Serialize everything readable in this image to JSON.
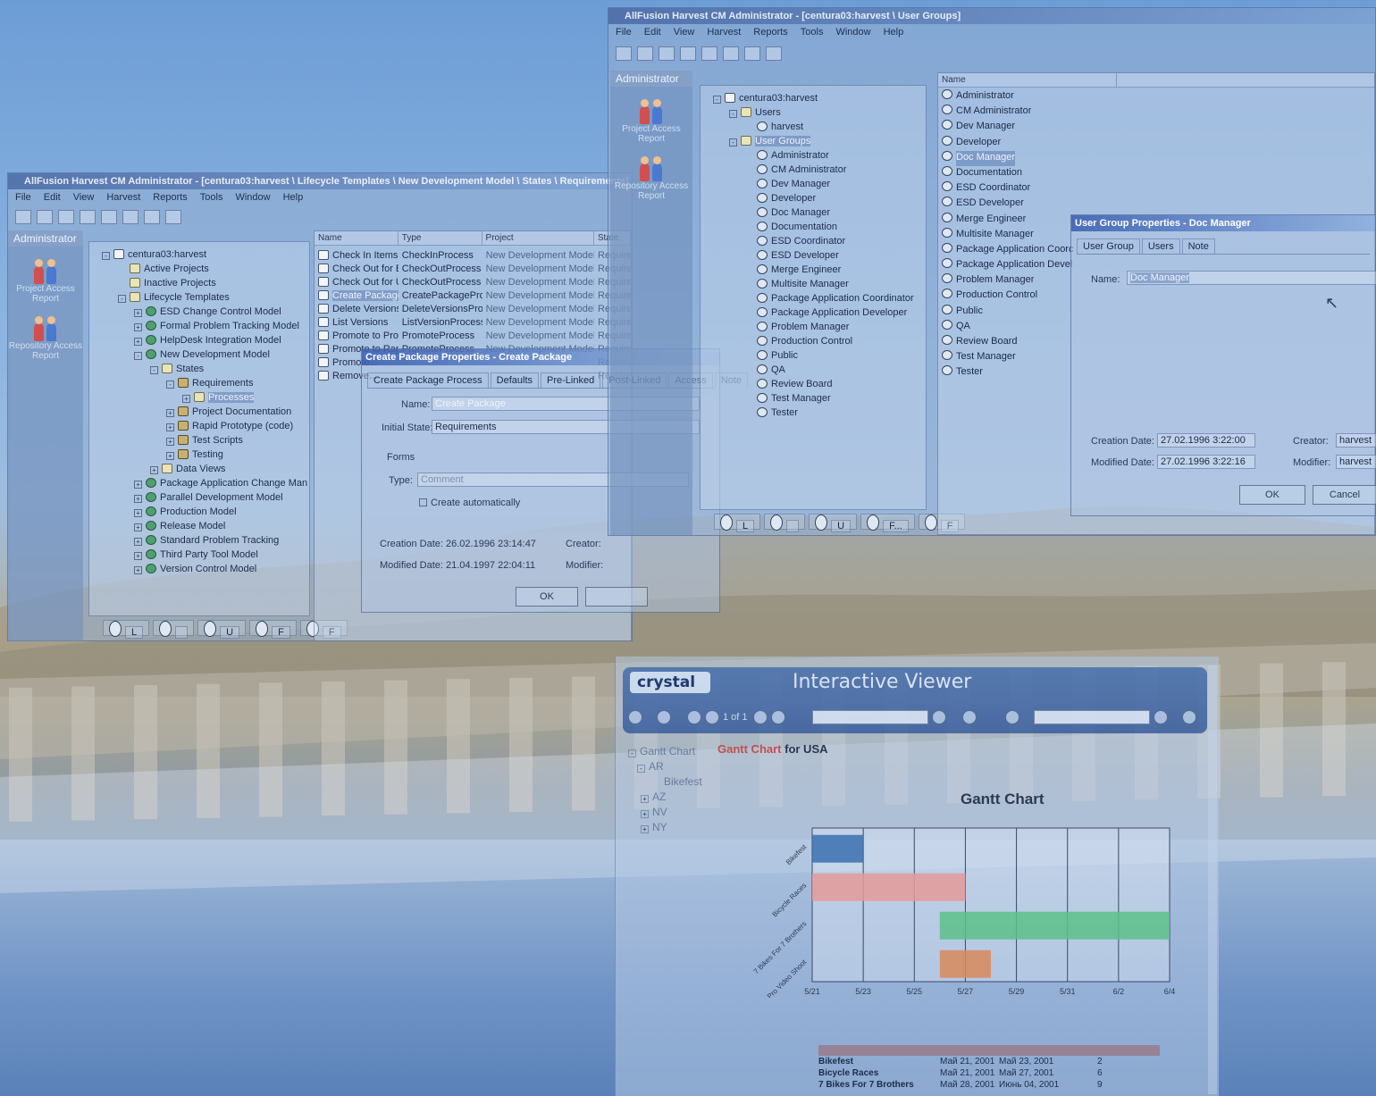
{
  "colors": {
    "accent": "#2f5aa8",
    "gantt_bar1": "#3a6fb0",
    "gantt_bar2": "#e49a9a",
    "gantt_bar3": "#5cc08a",
    "gantt_bar4": "#d88a5a",
    "crystal_header": "#3a64a8"
  },
  "win1": {
    "title": "AllFusion Harvest CM Administrator - [centura03:harvest \\ Lifecycle Templates \\ New Development Model \\ States \\ Requirements]",
    "menu": [
      "File",
      "Edit",
      "View",
      "Harvest",
      "Reports",
      "Tools",
      "Window",
      "Help"
    ],
    "side_header": "Administrator",
    "side_items": [
      "Project Access Report",
      "Repository Access Report"
    ],
    "tree": [
      {
        "label": "centura03:harvest",
        "icon": "server-icon",
        "level": 0,
        "exp": "-"
      },
      {
        "label": "Active Projects",
        "icon": "folder-icon",
        "level": 1,
        "exp": ""
      },
      {
        "label": "Inactive Projects",
        "icon": "folder-icon",
        "level": 1,
        "exp": ""
      },
      {
        "label": "Lifecycle Templates",
        "icon": "folder-icon",
        "level": 1,
        "exp": "-"
      },
      {
        "label": "ESD Change Control Model",
        "icon": "model-icon",
        "level": 2,
        "exp": "+"
      },
      {
        "label": "Formal Problem Tracking Model",
        "icon": "model-icon",
        "level": 2,
        "exp": "+"
      },
      {
        "label": "HelpDesk Integration Model",
        "icon": "model-icon",
        "level": 2,
        "exp": "+"
      },
      {
        "label": "New Development Model",
        "icon": "model-icon",
        "level": 2,
        "exp": "-"
      },
      {
        "label": "States",
        "icon": "folder-icon",
        "level": 3,
        "exp": "-"
      },
      {
        "label": "Requirements",
        "icon": "state-icon",
        "level": 4,
        "exp": "-"
      },
      {
        "label": "Processes",
        "icon": "folder-icon",
        "level": 5,
        "exp": "+",
        "selected": true
      },
      {
        "label": "Project Documentation",
        "icon": "state-icon",
        "level": 4,
        "exp": "+"
      },
      {
        "label": "Rapid Prototype (code)",
        "icon": "state-icon",
        "level": 4,
        "exp": "+"
      },
      {
        "label": "Test Scripts",
        "icon": "state-icon",
        "level": 4,
        "exp": "+"
      },
      {
        "label": "Testing",
        "icon": "state-icon",
        "level": 4,
        "exp": "+"
      },
      {
        "label": "Data Views",
        "icon": "folder-icon",
        "level": 3,
        "exp": "+"
      },
      {
        "label": "Package Application Change Man",
        "icon": "model-icon",
        "level": 2,
        "exp": "+"
      },
      {
        "label": "Parallel Development Model",
        "icon": "model-icon",
        "level": 2,
        "exp": "+"
      },
      {
        "label": "Production Model",
        "icon": "model-icon",
        "level": 2,
        "exp": "+"
      },
      {
        "label": "Release Model",
        "icon": "model-icon",
        "level": 2,
        "exp": "+"
      },
      {
        "label": "Standard Problem Tracking",
        "icon": "model-icon",
        "level": 2,
        "exp": "+"
      },
      {
        "label": "Third Party Tool Model",
        "icon": "model-icon",
        "level": 2,
        "exp": "+"
      },
      {
        "label": "Version Control Model",
        "icon": "model-icon",
        "level": 2,
        "exp": "+"
      }
    ],
    "columns": [
      "Name",
      "Type",
      "Project",
      "State"
    ],
    "rows": [
      {
        "name": "Check In Items",
        "type": "CheckInProcess",
        "project": "New Development Model",
        "state": "Requirements"
      },
      {
        "name": "Check Out for Browse",
        "type": "CheckOutProcess",
        "project": "New Development Model",
        "state": "Requirements"
      },
      {
        "name": "Check Out for Update",
        "type": "CheckOutProcess",
        "project": "New Development Model",
        "state": "Requirements"
      },
      {
        "name": "Create Package",
        "type": "CreatePackageProcess",
        "project": "New Development Model",
        "state": "Requirements"
      },
      {
        "name": "Delete Versions",
        "type": "DeleteVersionsProcess",
        "project": "New Development Model",
        "state": "Requirements"
      },
      {
        "name": "List Versions",
        "type": "ListVersionProcess",
        "project": "New Development Model",
        "state": "Requirements"
      },
      {
        "name": "Promote to Project Doc...",
        "type": "PromoteProcess",
        "project": "New Development Model",
        "state": "Requirements"
      },
      {
        "name": "Promote to Rapid Prototyp...",
        "type": "PromoteProcess",
        "project": "New Development Model",
        "state": "Requirements"
      },
      {
        "name": "Promote...",
        "type": "",
        "project": "",
        "state": "Requirements"
      },
      {
        "name": "Remove...",
        "type": "",
        "project": "",
        "state": "Requirements"
      }
    ],
    "bottom_tabs": [
      "L",
      "",
      "U",
      "F",
      "F"
    ]
  },
  "dlg1": {
    "title": "Create Package Properties - Create Package",
    "tabs": [
      "Create Package Process",
      "Defaults",
      "Pre-Linked",
      "Post-Linked",
      "Access",
      "Note"
    ],
    "name_label": "Name:",
    "name_value": "Create Package",
    "state_label": "Initial State:",
    "state_value": "Requirements",
    "forms_label": "Forms",
    "type_label": "Type:",
    "type_value": "Comment",
    "create_auto": "Create automatically",
    "created_label": "Creation Date:",
    "created_value": "26.02.1996 23:14:47",
    "creator_label": "Creator:",
    "modified_label": "Modified Date:",
    "modified_value": "21.04.1997 22:04:11",
    "modifier_label": "Modifier:",
    "ok": "OK"
  },
  "win2": {
    "title": "AllFusion Harvest CM Administrator - [centura03:harvest \\ User Groups]",
    "menu": [
      "File",
      "Edit",
      "View",
      "Harvest",
      "Reports",
      "Tools",
      "Window",
      "Help"
    ],
    "side_header": "Administrator",
    "side_items": [
      "Project Access Report",
      "Repository Access Report"
    ],
    "tree": [
      {
        "label": "centura03:harvest",
        "icon": "server-icon",
        "level": 0,
        "exp": "-"
      },
      {
        "label": "Users",
        "icon": "folder-icon",
        "level": 1,
        "exp": "-"
      },
      {
        "label": "harvest",
        "icon": "user-icon",
        "level": 2,
        "exp": ""
      },
      {
        "label": "User Groups",
        "icon": "folder-icon",
        "level": 1,
        "exp": "-",
        "selected": true
      },
      {
        "label": "Administrator",
        "icon": "group-icon",
        "level": 2,
        "exp": ""
      },
      {
        "label": "CM Administrator",
        "icon": "group-icon",
        "level": 2,
        "exp": ""
      },
      {
        "label": "Dev Manager",
        "icon": "group-icon",
        "level": 2,
        "exp": ""
      },
      {
        "label": "Developer",
        "icon": "group-icon",
        "level": 2,
        "exp": ""
      },
      {
        "label": "Doc Manager",
        "icon": "group-icon",
        "level": 2,
        "exp": ""
      },
      {
        "label": "Documentation",
        "icon": "group-icon",
        "level": 2,
        "exp": ""
      },
      {
        "label": "ESD Coordinator",
        "icon": "group-icon",
        "level": 2,
        "exp": ""
      },
      {
        "label": "ESD Developer",
        "icon": "group-icon",
        "level": 2,
        "exp": ""
      },
      {
        "label": "Merge Engineer",
        "icon": "group-icon",
        "level": 2,
        "exp": ""
      },
      {
        "label": "Multisite Manager",
        "icon": "group-icon",
        "level": 2,
        "exp": ""
      },
      {
        "label": "Package Application Coordinator",
        "icon": "group-icon",
        "level": 2,
        "exp": ""
      },
      {
        "label": "Package Application Developer",
        "icon": "group-icon",
        "level": 2,
        "exp": ""
      },
      {
        "label": "Problem Manager",
        "icon": "group-icon",
        "level": 2,
        "exp": ""
      },
      {
        "label": "Production Control",
        "icon": "group-icon",
        "level": 2,
        "exp": ""
      },
      {
        "label": "Public",
        "icon": "group-icon",
        "level": 2,
        "exp": ""
      },
      {
        "label": "QA",
        "icon": "group-icon",
        "level": 2,
        "exp": ""
      },
      {
        "label": "Review Board",
        "icon": "group-icon",
        "level": 2,
        "exp": ""
      },
      {
        "label": "Test Manager",
        "icon": "group-icon",
        "level": 2,
        "exp": ""
      },
      {
        "label": "Tester",
        "icon": "group-icon",
        "level": 2,
        "exp": ""
      }
    ],
    "list_header": "Name",
    "list": [
      "Administrator",
      "CM Administrator",
      "Dev Manager",
      "Developer",
      "Doc Manager",
      "Documentation",
      "ESD Coordinator",
      "ESD Developer",
      "Merge Engineer",
      "Multisite Manager",
      "Package Application Coorc",
      "Package Application Devel",
      "Problem Manager",
      "Production Control",
      "Public",
      "QA",
      "Review Board",
      "Test Manager",
      "Tester"
    ],
    "bottom_tabs": [
      "L",
      "",
      "U",
      "F...",
      "F"
    ]
  },
  "dlg2": {
    "title": "User Group Properties - Doc Manager",
    "tabs": [
      "User Group",
      "Users",
      "Note"
    ],
    "name_label": "Name:",
    "name_value": "Doc Manager",
    "created_label": "Creation Date:",
    "created_value": "27.02.1996 3:22:00",
    "creator_label": "Creator:",
    "creator_value": "harvest",
    "modified_label": "Modified Date:",
    "modified_value": "27.02.1996 3:22:16",
    "modifier_label": "Modifier:",
    "modifier_value": "harvest",
    "ok": "OK",
    "cancel": "Cancel"
  },
  "crystal": {
    "logo": "crystal",
    "title": "Interactive Viewer",
    "page": "1 of 1",
    "tree": [
      "Gantt Chart",
      "AR",
      "Bikefest",
      "AZ",
      "NV",
      "NY"
    ],
    "report_title_red": "Gantt Chart",
    "report_title_rest": " for USA",
    "chart_heading": "Gantt Chart",
    "table_rows": [
      {
        "name": "Bikefest",
        "start": "Май 21, 2001",
        "end": "Май 23, 2001",
        "n": "2"
      },
      {
        "name": "Bicycle Races",
        "start": "Май 21, 2001",
        "end": "Май 27, 2001",
        "n": "6"
      },
      {
        "name": "7 Bikes For 7 Brothers",
        "start": "Май 28, 2001",
        "end": "Июнь 04, 2001",
        "n": "9"
      }
    ]
  },
  "chart_data": {
    "type": "bar",
    "title": "Gantt Chart",
    "categories": [
      "Bikefest",
      "Bicycle Races",
      "7 Bikes For 7 Brothers",
      "Agents Pro Video Shoot"
    ],
    "x_ticks": [
      "5/21",
      "5/23",
      "5/25",
      "5/27",
      "5/29",
      "5/31",
      "6/2",
      "6/4"
    ],
    "series": [
      {
        "values": [
          [
            0,
            1
          ],
          [
            0,
            3
          ],
          [
            2.5,
            7
          ],
          [
            2.5,
            3.5
          ]
        ]
      }
    ],
    "xlim": [
      0,
      7
    ],
    "grid": true
  }
}
